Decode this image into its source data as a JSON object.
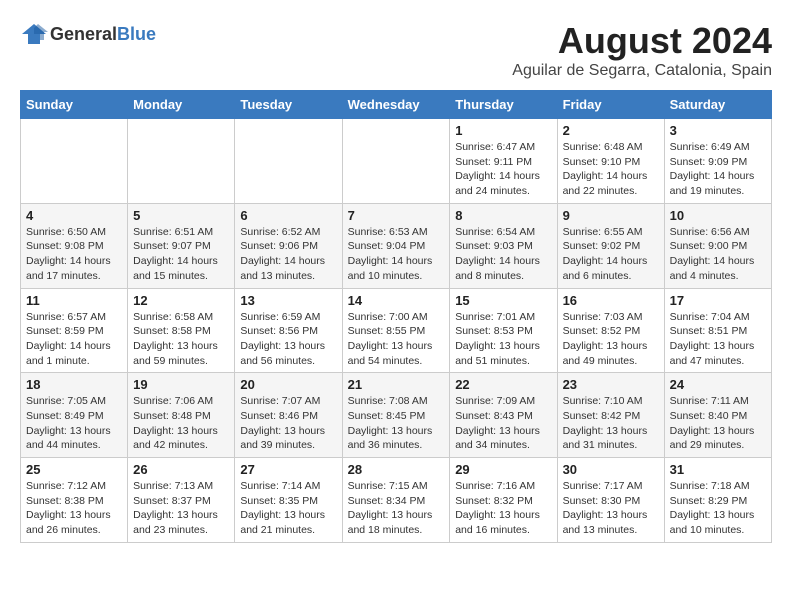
{
  "logo": {
    "text_general": "General",
    "text_blue": "Blue"
  },
  "header": {
    "title": "August 2024",
    "subtitle": "Aguilar de Segarra, Catalonia, Spain"
  },
  "days_of_week": [
    "Sunday",
    "Monday",
    "Tuesday",
    "Wednesday",
    "Thursday",
    "Friday",
    "Saturday"
  ],
  "weeks": [
    [
      {
        "day": "",
        "info": ""
      },
      {
        "day": "",
        "info": ""
      },
      {
        "day": "",
        "info": ""
      },
      {
        "day": "",
        "info": ""
      },
      {
        "day": "1",
        "info": "Sunrise: 6:47 AM\nSunset: 9:11 PM\nDaylight: 14 hours\nand 24 minutes."
      },
      {
        "day": "2",
        "info": "Sunrise: 6:48 AM\nSunset: 9:10 PM\nDaylight: 14 hours\nand 22 minutes."
      },
      {
        "day": "3",
        "info": "Sunrise: 6:49 AM\nSunset: 9:09 PM\nDaylight: 14 hours\nand 19 minutes."
      }
    ],
    [
      {
        "day": "4",
        "info": "Sunrise: 6:50 AM\nSunset: 9:08 PM\nDaylight: 14 hours\nand 17 minutes."
      },
      {
        "day": "5",
        "info": "Sunrise: 6:51 AM\nSunset: 9:07 PM\nDaylight: 14 hours\nand 15 minutes."
      },
      {
        "day": "6",
        "info": "Sunrise: 6:52 AM\nSunset: 9:06 PM\nDaylight: 14 hours\nand 13 minutes."
      },
      {
        "day": "7",
        "info": "Sunrise: 6:53 AM\nSunset: 9:04 PM\nDaylight: 14 hours\nand 10 minutes."
      },
      {
        "day": "8",
        "info": "Sunrise: 6:54 AM\nSunset: 9:03 PM\nDaylight: 14 hours\nand 8 minutes."
      },
      {
        "day": "9",
        "info": "Sunrise: 6:55 AM\nSunset: 9:02 PM\nDaylight: 14 hours\nand 6 minutes."
      },
      {
        "day": "10",
        "info": "Sunrise: 6:56 AM\nSunset: 9:00 PM\nDaylight: 14 hours\nand 4 minutes."
      }
    ],
    [
      {
        "day": "11",
        "info": "Sunrise: 6:57 AM\nSunset: 8:59 PM\nDaylight: 14 hours\nand 1 minute."
      },
      {
        "day": "12",
        "info": "Sunrise: 6:58 AM\nSunset: 8:58 PM\nDaylight: 13 hours\nand 59 minutes."
      },
      {
        "day": "13",
        "info": "Sunrise: 6:59 AM\nSunset: 8:56 PM\nDaylight: 13 hours\nand 56 minutes."
      },
      {
        "day": "14",
        "info": "Sunrise: 7:00 AM\nSunset: 8:55 PM\nDaylight: 13 hours\nand 54 minutes."
      },
      {
        "day": "15",
        "info": "Sunrise: 7:01 AM\nSunset: 8:53 PM\nDaylight: 13 hours\nand 51 minutes."
      },
      {
        "day": "16",
        "info": "Sunrise: 7:03 AM\nSunset: 8:52 PM\nDaylight: 13 hours\nand 49 minutes."
      },
      {
        "day": "17",
        "info": "Sunrise: 7:04 AM\nSunset: 8:51 PM\nDaylight: 13 hours\nand 47 minutes."
      }
    ],
    [
      {
        "day": "18",
        "info": "Sunrise: 7:05 AM\nSunset: 8:49 PM\nDaylight: 13 hours\nand 44 minutes."
      },
      {
        "day": "19",
        "info": "Sunrise: 7:06 AM\nSunset: 8:48 PM\nDaylight: 13 hours\nand 42 minutes."
      },
      {
        "day": "20",
        "info": "Sunrise: 7:07 AM\nSunset: 8:46 PM\nDaylight: 13 hours\nand 39 minutes."
      },
      {
        "day": "21",
        "info": "Sunrise: 7:08 AM\nSunset: 8:45 PM\nDaylight: 13 hours\nand 36 minutes."
      },
      {
        "day": "22",
        "info": "Sunrise: 7:09 AM\nSunset: 8:43 PM\nDaylight: 13 hours\nand 34 minutes."
      },
      {
        "day": "23",
        "info": "Sunrise: 7:10 AM\nSunset: 8:42 PM\nDaylight: 13 hours\nand 31 minutes."
      },
      {
        "day": "24",
        "info": "Sunrise: 7:11 AM\nSunset: 8:40 PM\nDaylight: 13 hours\nand 29 minutes."
      }
    ],
    [
      {
        "day": "25",
        "info": "Sunrise: 7:12 AM\nSunset: 8:38 PM\nDaylight: 13 hours\nand 26 minutes."
      },
      {
        "day": "26",
        "info": "Sunrise: 7:13 AM\nSunset: 8:37 PM\nDaylight: 13 hours\nand 23 minutes."
      },
      {
        "day": "27",
        "info": "Sunrise: 7:14 AM\nSunset: 8:35 PM\nDaylight: 13 hours\nand 21 minutes."
      },
      {
        "day": "28",
        "info": "Sunrise: 7:15 AM\nSunset: 8:34 PM\nDaylight: 13 hours\nand 18 minutes."
      },
      {
        "day": "29",
        "info": "Sunrise: 7:16 AM\nSunset: 8:32 PM\nDaylight: 13 hours\nand 16 minutes."
      },
      {
        "day": "30",
        "info": "Sunrise: 7:17 AM\nSunset: 8:30 PM\nDaylight: 13 hours\nand 13 minutes."
      },
      {
        "day": "31",
        "info": "Sunrise: 7:18 AM\nSunset: 8:29 PM\nDaylight: 13 hours\nand 10 minutes."
      }
    ]
  ]
}
